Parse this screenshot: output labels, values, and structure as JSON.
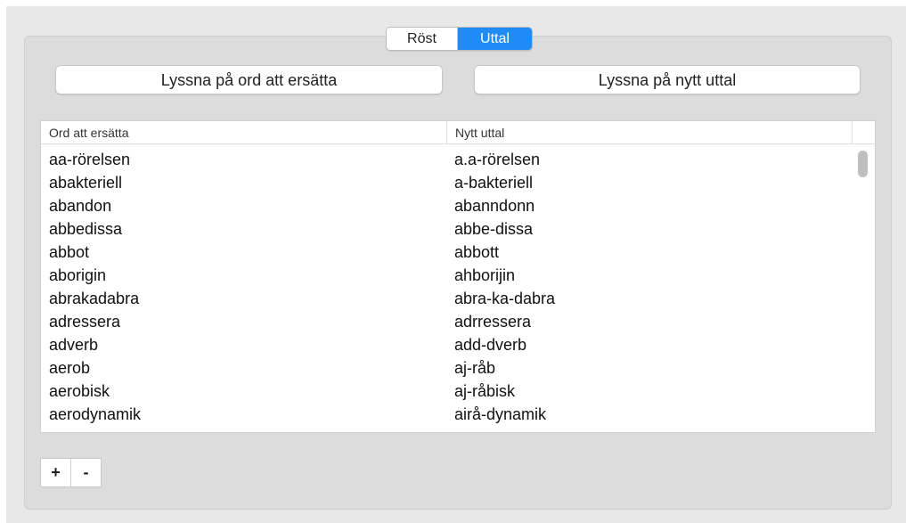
{
  "segmented": {
    "options": [
      "Röst",
      "Uttal"
    ],
    "selected": "Uttal"
  },
  "buttons": {
    "listen_original": "Lyssna på ord att ersätta",
    "listen_new": "Lyssna på nytt uttal"
  },
  "table": {
    "columns": [
      "Ord att ersätta",
      "Nytt uttal"
    ],
    "rows": [
      {
        "word": "aa-rörelsen",
        "pronunciation": "a.a-rörelsen"
      },
      {
        "word": "abakteriell",
        "pronunciation": "a-bakteriell"
      },
      {
        "word": "abandon",
        "pronunciation": "abanndonn"
      },
      {
        "word": "abbedissa",
        "pronunciation": "abbe-dissa"
      },
      {
        "word": "abbot",
        "pronunciation": "abbott"
      },
      {
        "word": "aborigin",
        "pronunciation": "ahborijin"
      },
      {
        "word": "abrakadabra",
        "pronunciation": "abra-ka-dabra"
      },
      {
        "word": "adressera",
        "pronunciation": "adrressera"
      },
      {
        "word": "adverb",
        "pronunciation": "add-dverb"
      },
      {
        "word": "aerob",
        "pronunciation": "aj-råb"
      },
      {
        "word": "aerobisk",
        "pronunciation": "aj-råbisk"
      },
      {
        "word": "aerodynamik",
        "pronunciation": "airå-dynamik"
      }
    ]
  },
  "controls": {
    "add_label": "+",
    "remove_label": "-"
  },
  "colors": {
    "accent": "#1f8cf5",
    "panel_bg": "#dcdcdc"
  }
}
